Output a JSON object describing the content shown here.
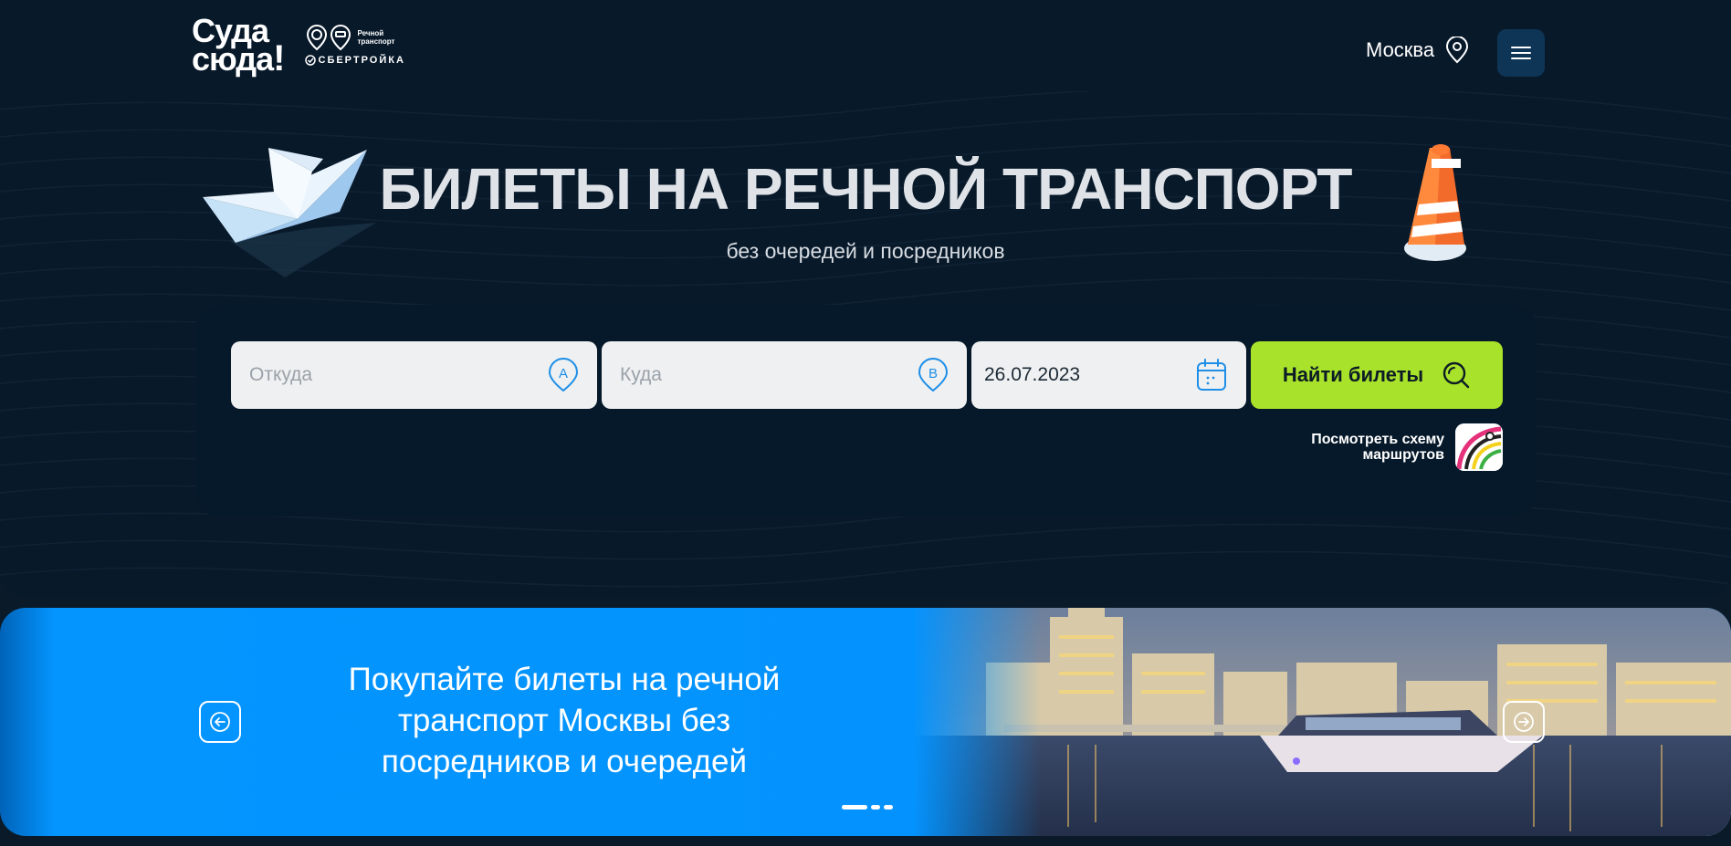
{
  "header": {
    "logo_line1": "Суда",
    "logo_line2": "сюда",
    "logo_bang": "!",
    "partner_line1": "Речной",
    "partner_line2": "транспорт",
    "partner_sber": "СБЕРТРОЙКА",
    "city": "Москва"
  },
  "hero": {
    "title": "БИЛЕТЫ НА РЕЧНОЙ ТРАНСПОРТ",
    "subtitle": "без очередей и посредников"
  },
  "search": {
    "from_placeholder": "Откуда",
    "to_placeholder": "Куда",
    "from_badge": "A",
    "to_badge": "B",
    "date": "26.07.2023",
    "find_label": "Найти билеты",
    "scheme_line1": "Посмотреть схему",
    "scheme_line2": "маршрутов"
  },
  "banner": {
    "line1": "Покупайте билеты на речной",
    "line2": "транспорт Москвы без",
    "line3": "посредников и очередей",
    "active_slide": 1,
    "slide_count": 3
  },
  "colors": {
    "background": "#08192a",
    "accent_green": "#a8e22a",
    "accent_blue": "#0493fe",
    "icon_blue": "#1e8fe8",
    "menu_button": "#0e3556"
  },
  "icons": {
    "city": "location-pin-icon",
    "menu": "hamburger-icon",
    "from": "point-a-icon",
    "to": "point-b-icon",
    "date": "calendar-icon",
    "find": "search-icon",
    "scheme": "route-map-icon",
    "prev": "arrow-left-icon",
    "next": "arrow-right-icon"
  }
}
